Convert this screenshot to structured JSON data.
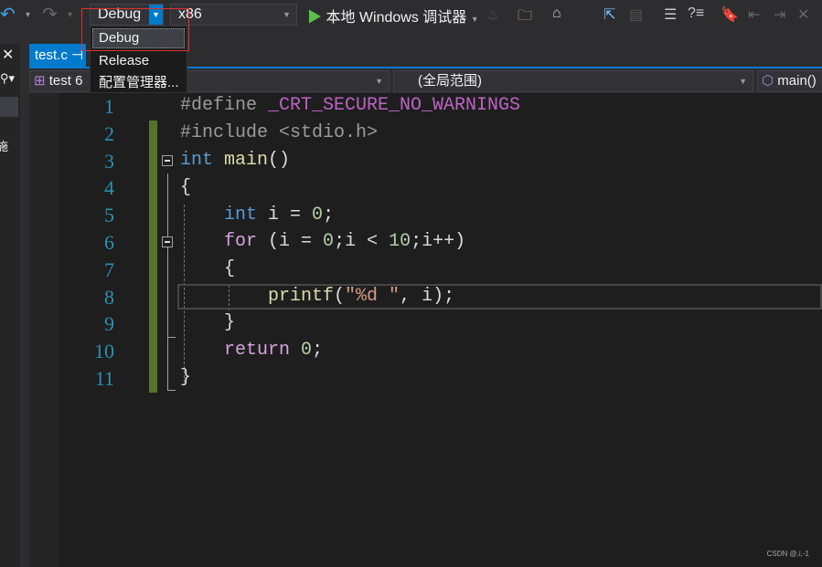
{
  "toolbar": {
    "config_selected": "Debug",
    "platform": "x86",
    "run_label": "本地 Windows 调试器"
  },
  "config_dropdown": {
    "items": [
      "Debug",
      "Release",
      "配置管理器..."
    ]
  },
  "tabs": [
    {
      "label": "test.c",
      "pin": "⊣"
    }
  ],
  "navbar": {
    "project": "test 6",
    "scope": "(全局范围)",
    "member": "main()"
  },
  "editor": {
    "line_numbers": [
      "1",
      "2",
      "3",
      "4",
      "5",
      "6",
      "7",
      "8",
      "9",
      "10",
      "11"
    ]
  },
  "left_panel": {
    "char": "施"
  },
  "watermark": "CSDN @,i,-1",
  "colors": {
    "accent": "#007acc",
    "keyword": "#569cd6",
    "control": "#d8a0df",
    "function": "#dcdcaa",
    "string": "#d69d85",
    "number": "#b5cea8",
    "line_number": "#2b91af",
    "changed_bar": "#57732b"
  }
}
